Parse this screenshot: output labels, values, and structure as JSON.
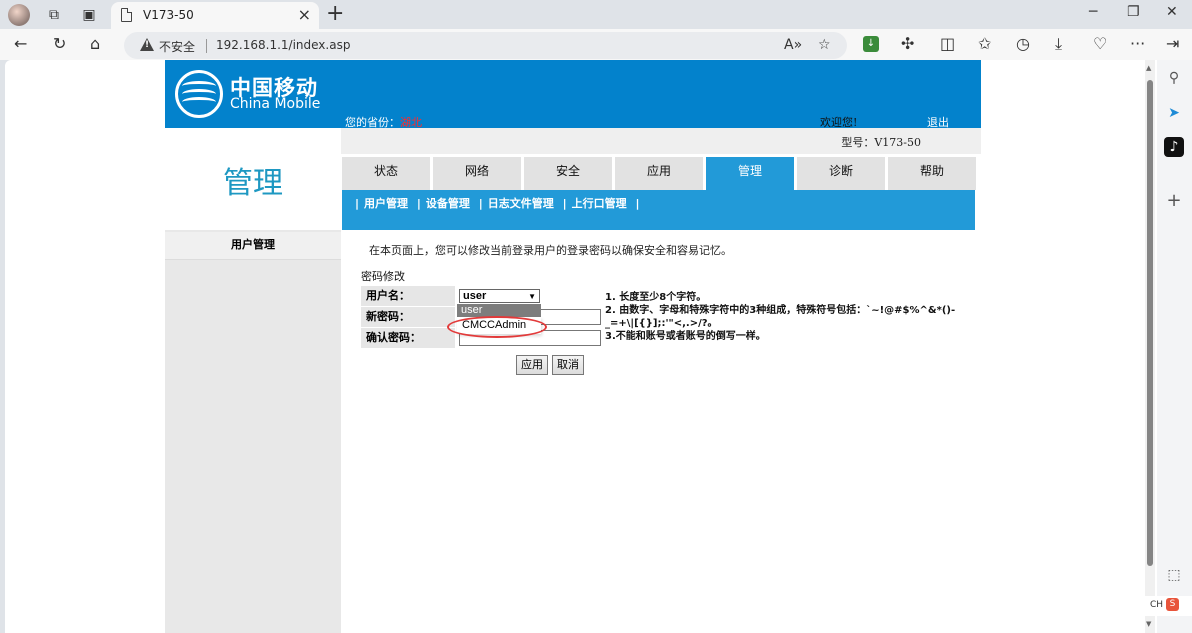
{
  "browser": {
    "tab_title": "V173-50",
    "not_secure": "不安全",
    "url": "192.168.1.1/index.asp"
  },
  "header": {
    "logo_cn": "中国移动",
    "logo_en": "China Mobile",
    "province_label": "您的省份：",
    "province_value": "湖北",
    "welcome": "欢迎您!",
    "logout": "退出"
  },
  "model": "型号：V173-50",
  "left": {
    "title": "管理",
    "items": [
      "用户管理"
    ]
  },
  "tabs": [
    {
      "label": "状态",
      "active": false
    },
    {
      "label": "网络",
      "active": false
    },
    {
      "label": "安全",
      "active": false
    },
    {
      "label": "应用",
      "active": false
    },
    {
      "label": "管理",
      "active": true
    },
    {
      "label": "诊断",
      "active": false
    },
    {
      "label": "帮助",
      "active": false
    }
  ],
  "subnav": [
    "用户管理",
    "设备管理",
    "日志文件管理",
    "上行口管理"
  ],
  "content": {
    "description": "在本页面上，您可以修改当前登录用户的登录密码以确保安全和容易记忆。",
    "section_title": "密码修改",
    "username_label": "用户名：",
    "new_password_label": "新密码：",
    "confirm_password_label": "确认密码：",
    "username_selected": "user",
    "username_options": [
      "user",
      "CMCCAdmin"
    ],
    "rules": [
      "1. 长度至少8个字符。",
      "2. 由数字、字母和特殊字符中的3种组成，特殊符号包括：`~!@#$%^&*()-_=+\\|[{}];:'\"<,.>/?。",
      "3.不能和账号或者账号的倒写一样。"
    ],
    "apply_button": "应用",
    "cancel_button": "取消"
  },
  "tray": {
    "lang": "CH",
    "ime": "S"
  },
  "colors": {
    "brand_blue": "#0382cc",
    "tab_active": "#229ad8",
    "annotation": "#e23a3a"
  }
}
